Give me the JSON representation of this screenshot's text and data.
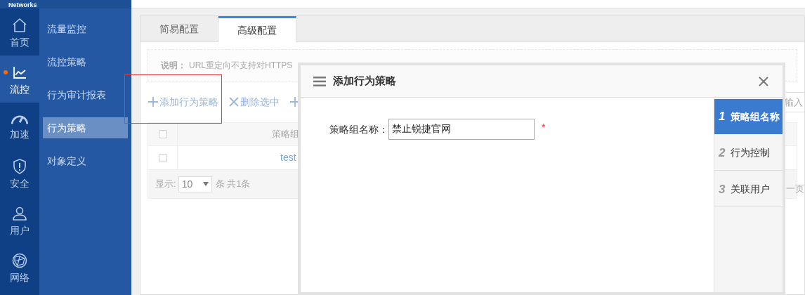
{
  "top_bar": {
    "brand": "Networks"
  },
  "nav_rail": [
    {
      "label": "首页",
      "selected": false
    },
    {
      "label": "流控",
      "selected": true
    },
    {
      "label": "加速",
      "selected": false
    },
    {
      "label": "安全",
      "selected": false
    },
    {
      "label": "用户",
      "selected": false
    },
    {
      "label": "网络",
      "selected": false
    }
  ],
  "sub_menu": [
    {
      "label": "流量监控",
      "selected": false
    },
    {
      "label": "流控策略",
      "selected": false
    },
    {
      "label": "行为审计报表",
      "selected": false
    },
    {
      "label": "行为策略",
      "selected": true
    },
    {
      "label": "对象定义",
      "selected": false
    }
  ],
  "tabs": [
    {
      "label": "简易配置",
      "selected": false
    },
    {
      "label": "高级配置",
      "selected": true
    }
  ],
  "notice": {
    "label": "说明：",
    "text": "URL重定向不支持对HTTPS"
  },
  "toolbar": [
    {
      "kind": "add",
      "label": "添加行为策略"
    },
    {
      "kind": "delete",
      "label": "删除选中"
    },
    {
      "kind": "add"
    }
  ],
  "search": {
    "placeholder": "输入"
  },
  "table": {
    "header_checked": false,
    "columns": [
      "策略组"
    ],
    "rows": [
      {
        "checked": false,
        "cells": [
          "test"
        ]
      }
    ]
  },
  "pagination": {
    "show_label": "显示:",
    "page_size": "10",
    "total": "条 共1条",
    "next": "一页"
  },
  "modal": {
    "title": "添加行为策略",
    "fields": [
      {
        "label": "策略组名称：",
        "value": "禁止锐捷官网",
        "required_mark": "*"
      }
    ],
    "steps": [
      {
        "number": "1",
        "label": "策略组名称",
        "selected": true
      },
      {
        "number": "2",
        "label": "行为控制",
        "selected": false
      },
      {
        "number": "3",
        "label": "关联用户",
        "selected": false
      }
    ]
  }
}
